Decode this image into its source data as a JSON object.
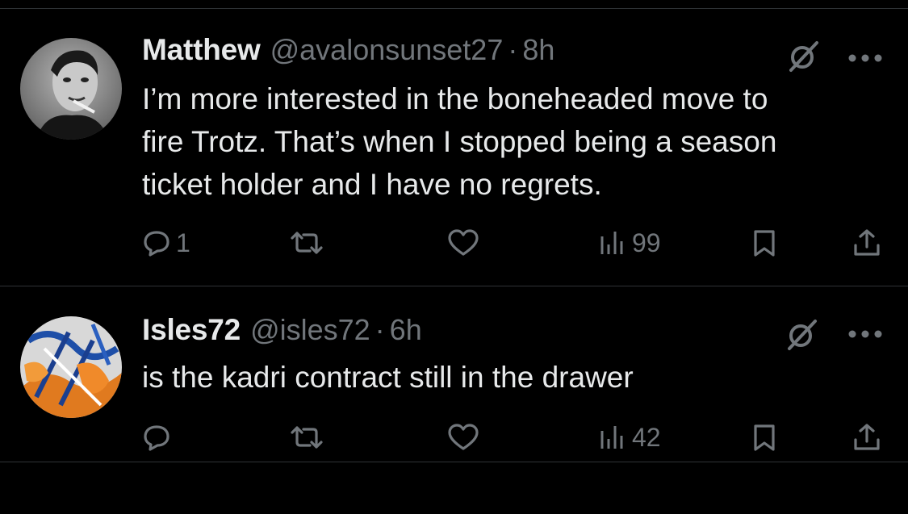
{
  "tweets": [
    {
      "display_name": "Matthew",
      "handle": "@avalonsunset27",
      "separator": "·",
      "time": "8h",
      "text": "I’m more interested in the boneheaded move to\nfire Trotz. That’s when I stopped being a season\nticket holder and I have no regrets.",
      "reply_count": "1",
      "retweet_count": "",
      "like_count": "",
      "view_count": "99",
      "avatar_icon": "avatar-photo-man-smoking"
    },
    {
      "display_name": "Isles72",
      "handle": "@isles72",
      "separator": "·",
      "time": "6h",
      "text": "is the kadri contract still in the drawer",
      "reply_count": "",
      "retweet_count": "",
      "like_count": "",
      "view_count": "42",
      "avatar_icon": "avatar-abstract-orange-blue"
    }
  ],
  "colors": {
    "background": "#000000",
    "text": "#e7e9ea",
    "muted": "#71767b",
    "divider": "#2f3336"
  }
}
